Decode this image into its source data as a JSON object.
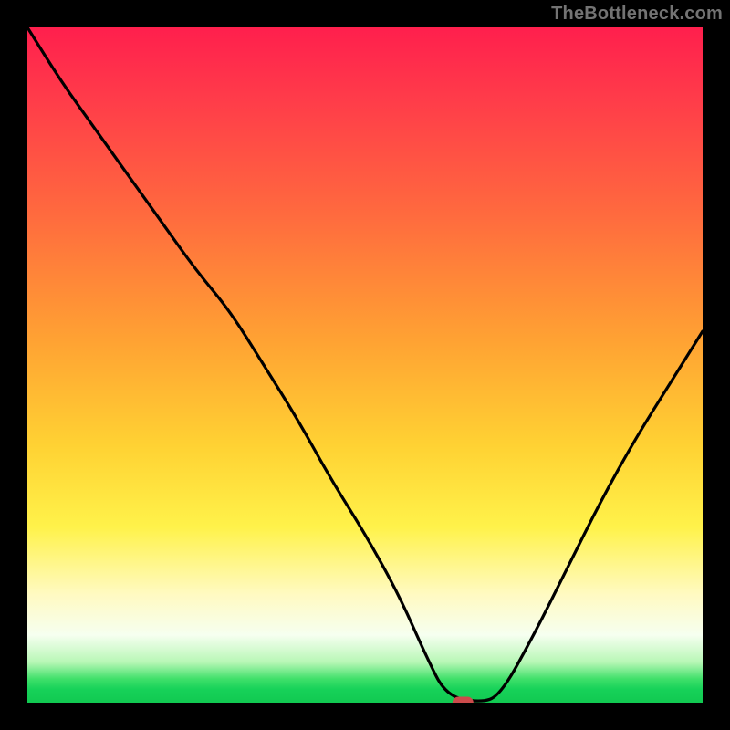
{
  "watermark": "TheBottleneck.com",
  "colors": {
    "background": "#000000",
    "watermark_text": "#737373",
    "curve_stroke": "#000000",
    "marker_fill": "#cc4b4b",
    "gradient_stops": [
      "#ff1f4d",
      "#ff3a4a",
      "#ff6b3e",
      "#ffa133",
      "#ffd233",
      "#fff24a",
      "#fffac2",
      "#f6fff0",
      "#b8f7b6",
      "#3fe06a",
      "#17d259",
      "#11c951"
    ]
  },
  "chart_data": {
    "type": "line",
    "title": "",
    "xlabel": "",
    "ylabel": "",
    "xlim": [
      0,
      100
    ],
    "ylim": [
      0,
      100
    ],
    "grid": false,
    "legend": false,
    "annotations": [
      {
        "text": "TheBottleneck.com",
        "position": "top-right"
      }
    ],
    "series": [
      {
        "name": "bottleneck-curve",
        "x": [
          0,
          5,
          10,
          15,
          20,
          25,
          30,
          35,
          40,
          45,
          50,
          55,
          59,
          62,
          67,
          70,
          75,
          80,
          85,
          90,
          95,
          100
        ],
        "values": [
          100,
          92,
          85,
          78,
          71,
          64,
          58,
          50,
          42,
          33,
          25,
          16,
          7,
          1,
          0,
          1,
          10,
          20,
          30,
          39,
          47,
          55
        ]
      }
    ],
    "marker": {
      "x": 64.5,
      "y": 0
    },
    "notes": "y-axis encodes bottleneck percentage (100 = top/red, 0 = bottom/green); x-axis is an unlabeled normalized index. Curve descends steeply from top-left, flattens near x≈60–68 at y≈0, then rises toward the right edge reaching roughly y≈55."
  }
}
